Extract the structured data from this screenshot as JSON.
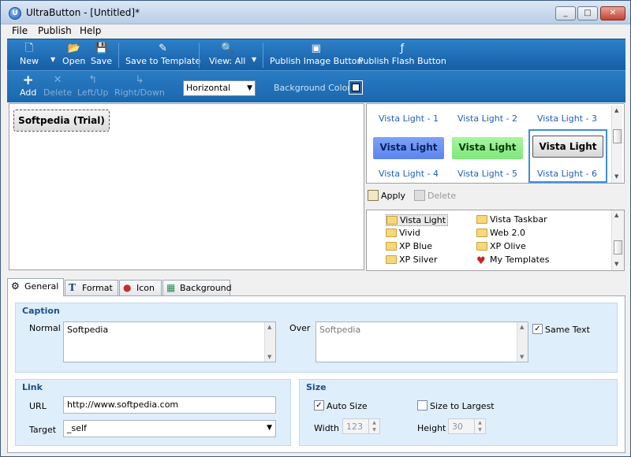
{
  "window": {
    "title": "UltraButton - [Untitled]*",
    "app_icon_letter": "U"
  },
  "caption_buttons": {
    "minimize": "_",
    "maximize": "□",
    "close": "✕"
  },
  "menu": [
    "File",
    "Publish",
    "Help"
  ],
  "toolbar_main": {
    "new": "New",
    "open": "Open",
    "save": "Save",
    "save_template": "Save to Template",
    "view": "View: All",
    "publish_image": "Publish Image Button",
    "publish_flash": "Publish Flash Button"
  },
  "toolbar_edit": {
    "add": "Add",
    "delete": "Delete",
    "left_up": "Left/Up",
    "right_down": "Right/Down",
    "orientation": "Horizontal",
    "background_color_label": "Background Color"
  },
  "canvas": {
    "button_text": "Softpedia (Trial)"
  },
  "styles": {
    "labels": [
      "Vista Light - 1",
      "Vista Light - 2",
      "Vista Light - 3",
      "Vista Light - 4",
      "Vista Light - 5",
      "Vista Light - 6"
    ],
    "previews": [
      "Vista Light",
      "Vista Light",
      "Vista Light"
    ],
    "apply": "Apply",
    "delete": "Delete"
  },
  "categories": {
    "left": [
      "Vista Light",
      "Vivid",
      "XP Blue",
      "XP Silver"
    ],
    "right": [
      "Vista Taskbar",
      "Web 2.0",
      "XP Olive",
      "My Templates"
    ]
  },
  "tabs": [
    "General",
    "Format",
    "Icon",
    "Background"
  ],
  "caption": {
    "title": "Caption",
    "normal_label": "Normal",
    "normal_value": "Softpedia",
    "over_label": "Over",
    "over_value": "Softpedia",
    "same_text_label": "Same Text",
    "same_text_checked": true
  },
  "link": {
    "title": "Link",
    "url_label": "URL",
    "url_value": "http://www.softpedia.com",
    "target_label": "Target",
    "target_value": "_self"
  },
  "size": {
    "title": "Size",
    "auto_size_label": "Auto Size",
    "auto_size_checked": true,
    "size_to_largest_label": "Size to Largest",
    "size_to_largest_checked": false,
    "width_label": "Width",
    "width_value": "123",
    "height_label": "Height",
    "height_value": "30"
  },
  "colors": {
    "toolbar": "#1d68ad",
    "accent_blue": "#1f5fb5",
    "group_bg": "#dfeefb"
  }
}
